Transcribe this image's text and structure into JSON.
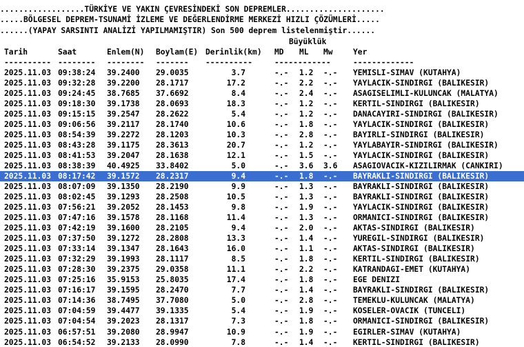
{
  "header_lines": [
    "..................TÜRKİYE VE YAKIN ÇEVRESİNDEKİ SON DEPREMLER.....................",
    ".....BÖLGESEL DEPREM-TSUNAMİ İZLEME VE DEĞERLENDİRME MERKEZİ HIZLI ÇÖZÜMLERİ.....",
    "......(YAPAY SARSINTI ANALİZİ YAPILMAMIŞTIR) Son 500 deprem listelenmiştir......"
  ],
  "magnitude_group_label": "Büyüklük",
  "columns": {
    "tarih": "Tarih",
    "saat": "Saat",
    "enlem": "Enlem(N)",
    "boylam": "Boylam(E)",
    "derinlik": "Derinlik(km)",
    "md": "MD",
    "ml": "ML",
    "mw": "Mw",
    "yer": "Yer"
  },
  "separators": {
    "tarih": "----------",
    "saat": "--------",
    "enlem": "--------",
    "boylam": "-------",
    "derinlik": "----------",
    "md": "------------",
    "yer": "-------------"
  },
  "highlighted_row": 10,
  "rows": [
    {
      "tarih": "2025.11.03",
      "saat": "09:38:24",
      "enlem": "39.2400",
      "boylam": "29.0035",
      "derinlik": "3.7",
      "md": "-.-",
      "ml": "1.2",
      "mw": "-.-",
      "yer": "YEMISLI-SIMAV (KUTAHYA)"
    },
    {
      "tarih": "2025.11.03",
      "saat": "09:32:28",
      "enlem": "39.2200",
      "boylam": "28.1717",
      "derinlik": "17.2",
      "md": "-.-",
      "ml": "2.2",
      "mw": "-.-",
      "yer": "YAYLACIK-SINDIRGI (BALIKESIR)"
    },
    {
      "tarih": "2025.11.03",
      "saat": "09:24:45",
      "enlem": "38.7685",
      "boylam": "37.6692",
      "derinlik": "8.4",
      "md": "-.-",
      "ml": "2.4",
      "mw": "-.-",
      "yer": "ASAGISELIMLI-KULUNCAK (MALATYA)"
    },
    {
      "tarih": "2025.11.03",
      "saat": "09:18:30",
      "enlem": "39.1738",
      "boylam": "28.0693",
      "derinlik": "18.3",
      "md": "-.-",
      "ml": "1.2",
      "mw": "-.-",
      "yer": "KERTIL-SINDIRGI (BALIKESIR)"
    },
    {
      "tarih": "2025.11.03",
      "saat": "09:15:15",
      "enlem": "39.2547",
      "boylam": "28.2622",
      "derinlik": "5.4",
      "md": "-.-",
      "ml": "1.2",
      "mw": "-.-",
      "yer": "DANACAYIRI-SINDIRGI (BALIKESIR)"
    },
    {
      "tarih": "2025.11.03",
      "saat": "09:06:56",
      "enlem": "39.2117",
      "boylam": "28.1740",
      "derinlik": "10.6",
      "md": "-.-",
      "ml": "1.8",
      "mw": "-.-",
      "yer": "YAYLACIK-SINDIRGI (BALIKESIR)"
    },
    {
      "tarih": "2025.11.03",
      "saat": "08:54:39",
      "enlem": "39.2272",
      "boylam": "28.1203",
      "derinlik": "10.3",
      "md": "-.-",
      "ml": "2.8",
      "mw": "-.-",
      "yer": "BAYIRLI-SINDIRGI (BALIKESIR)"
    },
    {
      "tarih": "2025.11.03",
      "saat": "08:43:28",
      "enlem": "39.1175",
      "boylam": "28.3613",
      "derinlik": "20.7",
      "md": "-.-",
      "ml": "1.2",
      "mw": "-.-",
      "yer": "YAYLABAYIR-SINDIRGI (BALIKESIR)"
    },
    {
      "tarih": "2025.11.03",
      "saat": "08:41:53",
      "enlem": "39.2047",
      "boylam": "28.1638",
      "derinlik": "12.1",
      "md": "-.-",
      "ml": "1.5",
      "mw": "-.-",
      "yer": "YAYLACIK-SINDIRGI (BALIKESIR)"
    },
    {
      "tarih": "2025.11.03",
      "saat": "08:38:39",
      "enlem": "40.4925",
      "boylam": "33.8402",
      "derinlik": "5.0",
      "md": "-.-",
      "ml": "3.6",
      "mw": "3.6",
      "yer": "ASAGIOVACIK-KIZILIRMAK (CANKIRI)"
    },
    {
      "tarih": "2025.11.03",
      "saat": "08:17:42",
      "enlem": "39.1572",
      "boylam": "28.2317",
      "derinlik": "9.4",
      "md": "-.-",
      "ml": "1.8",
      "mw": "-.-",
      "yer": "BAYRAKLI-SINDIRGI (BALIKESIR)"
    },
    {
      "tarih": "2025.11.03",
      "saat": "08:07:09",
      "enlem": "39.1350",
      "boylam": "28.2190",
      "derinlik": "9.9",
      "md": "-.-",
      "ml": "1.3",
      "mw": "-.-",
      "yer": "BAYRAKLI-SINDIRGI (BALIKESIR)"
    },
    {
      "tarih": "2025.11.03",
      "saat": "08:02:45",
      "enlem": "39.1293",
      "boylam": "28.2508",
      "derinlik": "10.5",
      "md": "-.-",
      "ml": "1.3",
      "mw": "-.-",
      "yer": "BAYRAKLI-SINDIRGI (BALIKESIR)"
    },
    {
      "tarih": "2025.11.03",
      "saat": "07:56:21",
      "enlem": "39.2052",
      "boylam": "28.1453",
      "derinlik": "9.8",
      "md": "-.-",
      "ml": "1.9",
      "mw": "-.-",
      "yer": "YAYLACIK-SINDIRGI (BALIKESIR)"
    },
    {
      "tarih": "2025.11.03",
      "saat": "07:47:16",
      "enlem": "39.1578",
      "boylam": "28.1168",
      "derinlik": "11.4",
      "md": "-.-",
      "ml": "1.3",
      "mw": "-.-",
      "yer": "ORMANICI-SINDIRGI (BALIKESIR)"
    },
    {
      "tarih": "2025.11.03",
      "saat": "07:42:19",
      "enlem": "39.1600",
      "boylam": "28.2105",
      "derinlik": "9.4",
      "md": "-.-",
      "ml": "2.0",
      "mw": "-.-",
      "yer": "AKTAS-SINDIRGI (BALIKESIR)"
    },
    {
      "tarih": "2025.11.03",
      "saat": "07:37:50",
      "enlem": "39.1272",
      "boylam": "28.2808",
      "derinlik": "13.3",
      "md": "-.-",
      "ml": "1.4",
      "mw": "-.-",
      "yer": "YUREGIL-SINDIRGI (BALIKESIR)"
    },
    {
      "tarih": "2025.11.03",
      "saat": "07:33:14",
      "enlem": "39.1347",
      "boylam": "28.1643",
      "derinlik": "16.0",
      "md": "-.-",
      "ml": "1.1",
      "mw": "-.-",
      "yer": "AKTAS-SINDIRGI (BALIKESIR)"
    },
    {
      "tarih": "2025.11.03",
      "saat": "07:32:29",
      "enlem": "39.1993",
      "boylam": "28.1117",
      "derinlik": "8.5",
      "md": "-.-",
      "ml": "1.8",
      "mw": "-.-",
      "yer": "KERTIL-SINDIRGI (BALIKESIR)"
    },
    {
      "tarih": "2025.11.03",
      "saat": "07:28:30",
      "enlem": "39.2375",
      "boylam": "29.0358",
      "derinlik": "11.1",
      "md": "-.-",
      "ml": "2.2",
      "mw": "-.-",
      "yer": "KATRANDAGI-EMET (KUTAHYA)"
    },
    {
      "tarih": "2025.11.03",
      "saat": "07:25:16",
      "enlem": "35.9153",
      "boylam": "25.8035",
      "derinlik": "17.4",
      "md": "-.-",
      "ml": "1.8",
      "mw": "-.-",
      "yer": "EGE DENIZI"
    },
    {
      "tarih": "2025.11.03",
      "saat": "07:16:17",
      "enlem": "39.1595",
      "boylam": "28.2470",
      "derinlik": "7.7",
      "md": "-.-",
      "ml": "1.4",
      "mw": "-.-",
      "yer": "BAYRAKLI-SINDIRGI (BALIKESIR)"
    },
    {
      "tarih": "2025.11.03",
      "saat": "07:14:36",
      "enlem": "38.7495",
      "boylam": "37.7080",
      "derinlik": "5.0",
      "md": "-.-",
      "ml": "2.8",
      "mw": "-.-",
      "yer": "TEMEKLU-KULUNCAK (MALATYA)"
    },
    {
      "tarih": "2025.11.03",
      "saat": "07:04:59",
      "enlem": "39.4477",
      "boylam": "39.1335",
      "derinlik": "5.4",
      "md": "-.-",
      "ml": "1.9",
      "mw": "-.-",
      "yer": "KOSELER-OVACIK (TUNCELI)"
    },
    {
      "tarih": "2025.11.03",
      "saat": "07:04:54",
      "enlem": "39.2023",
      "boylam": "28.1317",
      "derinlik": "7.3",
      "md": "-.-",
      "ml": "1.8",
      "mw": "-.-",
      "yer": "ORMANICI-SINDIRGI (BALIKESIR)"
    },
    {
      "tarih": "2025.11.03",
      "saat": "06:57:51",
      "enlem": "39.2080",
      "boylam": "28.9947",
      "derinlik": "10.9",
      "md": "-.-",
      "ml": "1.9",
      "mw": "-.-",
      "yer": "EGIRLER-SIMAV (KUTAHYA)"
    },
    {
      "tarih": "2025.11.03",
      "saat": "06:54:52",
      "enlem": "39.2133",
      "boylam": "28.0990",
      "derinlik": "7.8",
      "md": "-.-",
      "ml": "1.4",
      "mw": "-.-",
      "yer": "KERTIL-SINDIRGI (BALIKESIR)"
    }
  ]
}
